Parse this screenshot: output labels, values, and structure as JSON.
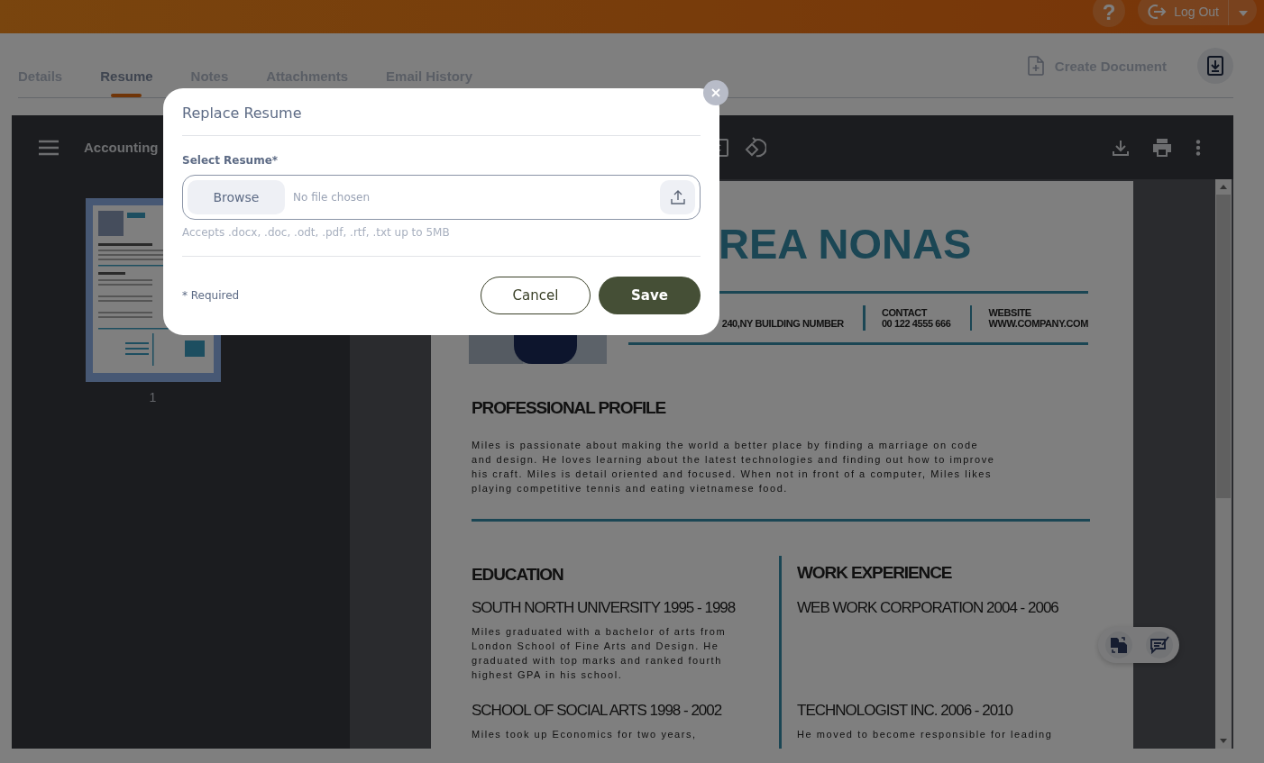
{
  "top_bar": {
    "help": "?",
    "logout": "Log Out"
  },
  "tabs": [
    {
      "label": "Details",
      "selected": false
    },
    {
      "label": "Resume",
      "selected": true
    },
    {
      "label": "Notes",
      "selected": false
    },
    {
      "label": "Attachments",
      "selected": false
    },
    {
      "label": "Email History",
      "selected": false
    }
  ],
  "create_document": "Create Document",
  "viewer": {
    "title": "Accounting",
    "thumbnail_page": "1"
  },
  "resume": {
    "name": "REA NONAS",
    "address": "240,NY BUILDING NUMBER",
    "contact_label": "CONTACT",
    "contact": "00 122 4555 666",
    "website_label": "WEBSITE",
    "website": "WWW.COMPANY.COM",
    "profile_heading": "PROFESSIONAL PROFILE",
    "profile": "Miles is passionate about making the world a better place by finding a marriage on code\nand design. He loves learning about the latest technologies and finding out how to improve\nhis craft. Miles is detail oriented and focused.  When not in front of a computer, Miles likes\nplaying competitive tennis and eating vietnamese food.",
    "education_heading": "EDUCATION",
    "work_heading": "WORK EXPERIENCE",
    "education": [
      {
        "title": "SOUTH NORTH UNIVERSITY 1995 - 1998",
        "text": "Miles graduated with a bachelor of arts from\nLondon School of Fine Arts and Design. He\ngraduated with top marks and ranked fourth\nhighest GPA in his school."
      },
      {
        "title": "SCHOOL OF SOCIAL ARTS 1998 - 2002",
        "text": "Miles took up Economics for two years,"
      }
    ],
    "work": [
      {
        "title": "WEB WORK CORPORATION 2004 - 2006"
      },
      {
        "title": "TECHNOLOGIST INC. 2006 - 2010",
        "text": "He moved to become responsible for leading"
      }
    ]
  },
  "dialog": {
    "title": "Replace Resume",
    "field_label": "Select Resume*",
    "browse": "Browse",
    "placeholder": "No file chosen",
    "hint": "Accepts .docx, .doc, .odt, .pdf, .rtf, .txt up to 5MB",
    "required_note": "* Required",
    "cancel": "Cancel",
    "save": "Save"
  }
}
